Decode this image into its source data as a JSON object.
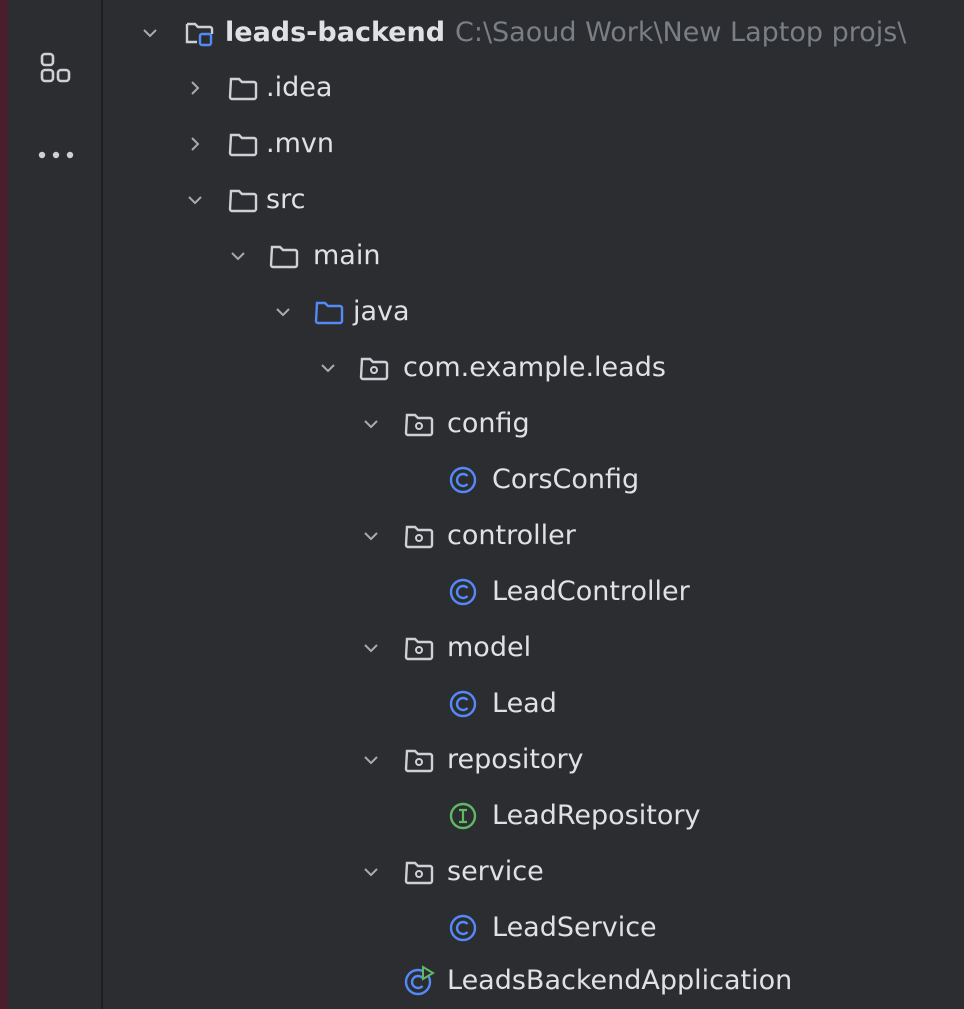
{
  "toolstrip": {
    "items": [
      {
        "icon": "project-structure-icon"
      },
      {
        "icon": "more-icon"
      }
    ]
  },
  "tree": {
    "root": {
      "label": "leads-backend",
      "path": "C:\\Saoud Work\\New Laptop projs\\"
    },
    "items": [
      {
        "label": ".idea"
      },
      {
        "label": ".mvn"
      },
      {
        "label": "src"
      },
      {
        "label": "main"
      },
      {
        "label": "java"
      },
      {
        "label": "com.example.leads"
      },
      {
        "label": "config"
      },
      {
        "label": "CorsConfig"
      },
      {
        "label": "controller"
      },
      {
        "label": "LeadController"
      },
      {
        "label": "model"
      },
      {
        "label": "Lead"
      },
      {
        "label": "repository"
      },
      {
        "label": "LeadRepository"
      },
      {
        "label": "service"
      },
      {
        "label": "LeadService"
      },
      {
        "label": "LeadsBackendApplication"
      }
    ]
  },
  "colors": {
    "background": "#2b2d30",
    "text": "#dfe1e5",
    "muted": "#7a7e85",
    "class_icon": "#548af7",
    "interface_icon": "#5fb865",
    "source_folder": "#548af7"
  }
}
